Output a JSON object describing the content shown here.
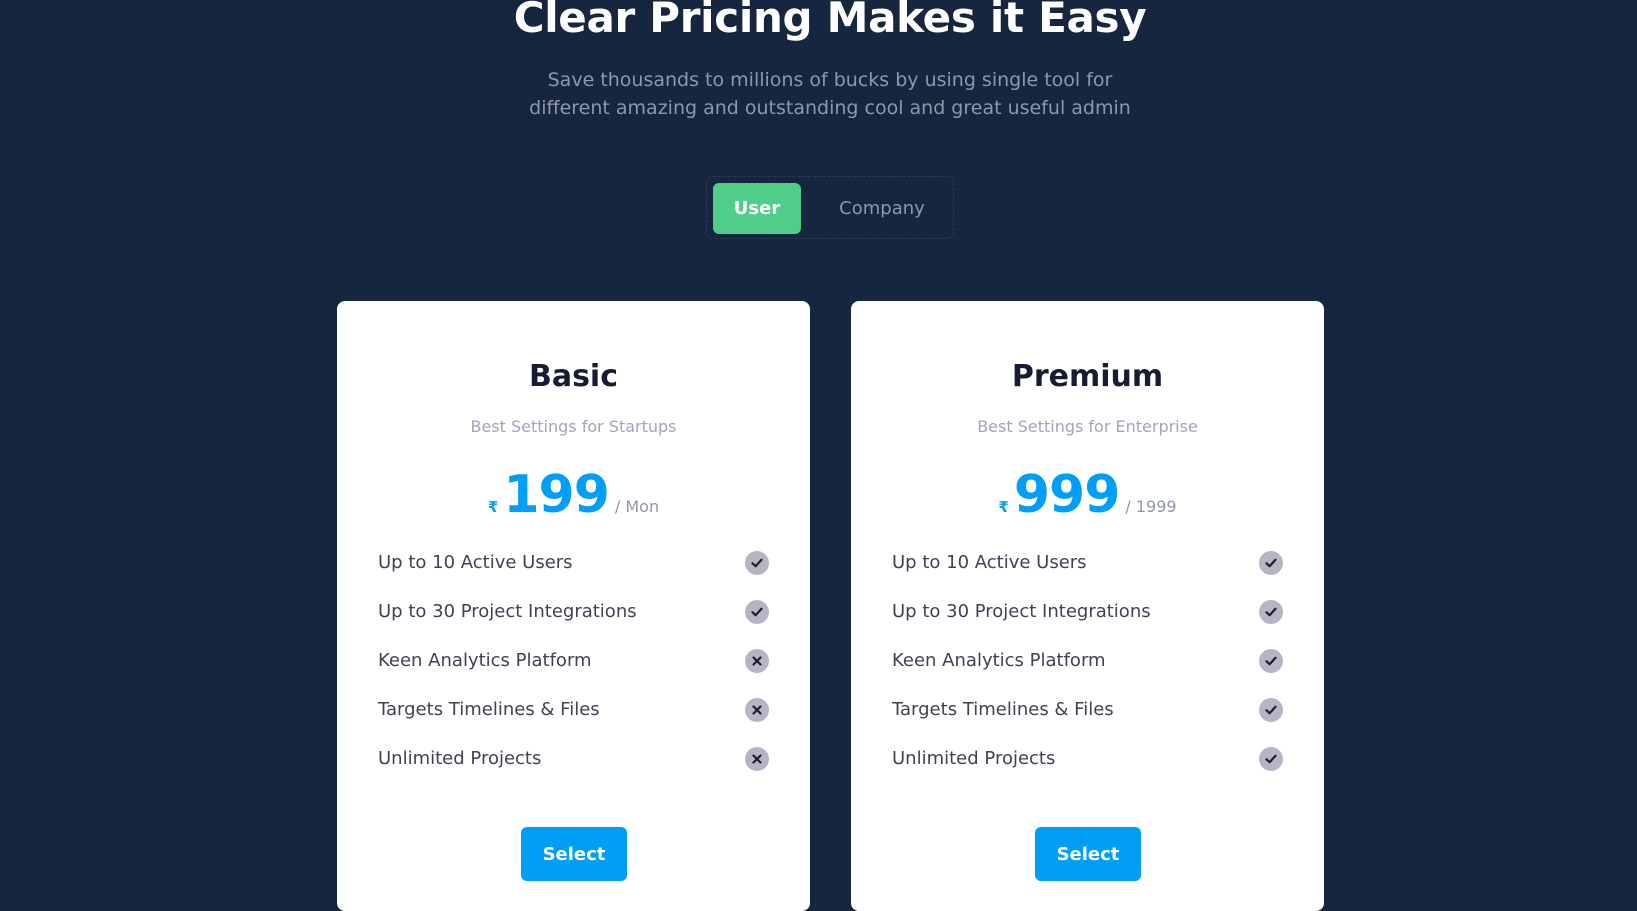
{
  "hero": {
    "title": "Clear Pricing Makes it Easy",
    "subtitle": "Save thousands to millions of bucks by using single tool for different amazing and outstanding cool and great useful admin"
  },
  "toggle": {
    "options": [
      {
        "label": "User",
        "active": true
      },
      {
        "label": "Company",
        "active": false
      }
    ]
  },
  "plans": [
    {
      "name": "Basic",
      "description": "Best Settings for Startups",
      "currency": "₹",
      "price": "199",
      "period": "/ Mon",
      "features": [
        {
          "label": "Up to 10 Active Users",
          "included": true,
          "icon": "check-icon"
        },
        {
          "label": "Up to 30 Project Integrations",
          "included": true,
          "icon": "check-icon"
        },
        {
          "label": "Keen Analytics Platform",
          "included": false,
          "icon": "cross-icon"
        },
        {
          "label": "Targets Timelines & Files",
          "included": false,
          "icon": "cross-icon"
        },
        {
          "label": "Unlimited Projects",
          "included": false,
          "icon": "cross-icon"
        }
      ],
      "button_label": "Select"
    },
    {
      "name": "Premium",
      "description": "Best Settings for Enterprise",
      "currency": "₹",
      "price": "999",
      "period": "/ 1999",
      "features": [
        {
          "label": "Up to 10 Active Users",
          "included": true,
          "icon": "check-icon"
        },
        {
          "label": "Up to 30 Project Integrations",
          "included": true,
          "icon": "check-icon"
        },
        {
          "label": "Keen Analytics Platform",
          "included": true,
          "icon": "check-icon"
        },
        {
          "label": "Targets Timelines & Files",
          "included": true,
          "icon": "check-icon"
        },
        {
          "label": "Unlimited Projects",
          "included": true,
          "icon": "check-icon"
        }
      ],
      "button_label": "Select"
    }
  ],
  "colors": {
    "background": "#16263e",
    "accent": "#009ef7",
    "toggle_active": "#50cd89",
    "icon_bg": "#b5b5c3"
  }
}
